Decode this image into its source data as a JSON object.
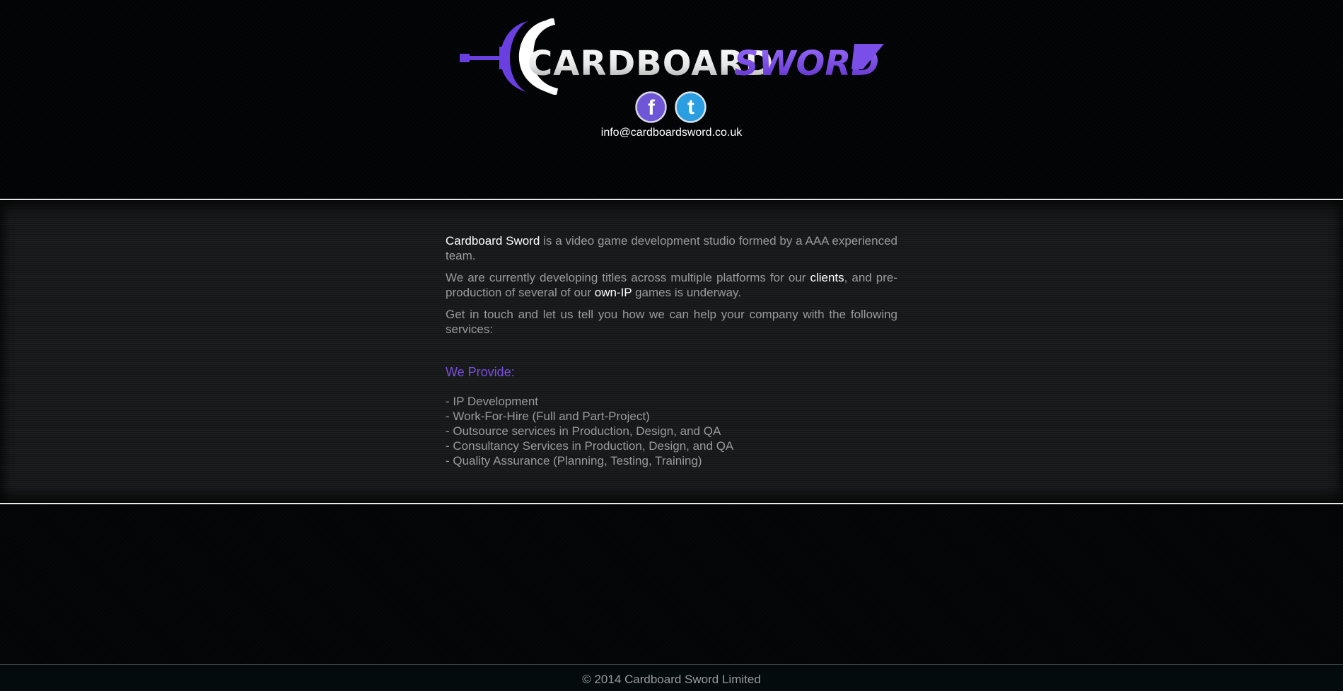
{
  "header": {
    "logo_text_light": "CARDBOARD",
    "logo_text_accent": "SWORD",
    "social": [
      {
        "name": "facebook",
        "glyph": "f",
        "icon": "facebook-icon"
      },
      {
        "name": "twitter",
        "glyph": "t",
        "icon": "twitter-icon"
      }
    ],
    "email": "info@cardboardsword.co.uk"
  },
  "main": {
    "intro": {
      "brand": "Cardboard Sword",
      "rest": " is a video game development studio formed by a AAA experienced team."
    },
    "paragraph2": {
      "part1": "We are currently developing titles across multiple platforms for our ",
      "link1": "clients",
      "part2": ", and pre-production of several of our ",
      "link2": "own-IP",
      "part3": " games is underway."
    },
    "paragraph3": "Get in touch and let us tell you how we can help your company with the following services:",
    "provide_title": "We Provide:",
    "services": [
      "- IP Development",
      "- Work-For-Hire (Full and Part-Project)",
      "- Outsource services in Production, Design, and QA",
      "- Consultancy Services in Production, Design, and QA",
      "- Quality Assurance (Planning, Testing, Training)"
    ]
  },
  "footer": {
    "copyright": "© 2014 Cardboard Sword Limited"
  },
  "colors": {
    "accent": "#7b4fe0",
    "facebook": "#6f56d6",
    "twitter": "#2a9ee0",
    "text": "#9a9a9a",
    "highlight": "#ffffff"
  }
}
